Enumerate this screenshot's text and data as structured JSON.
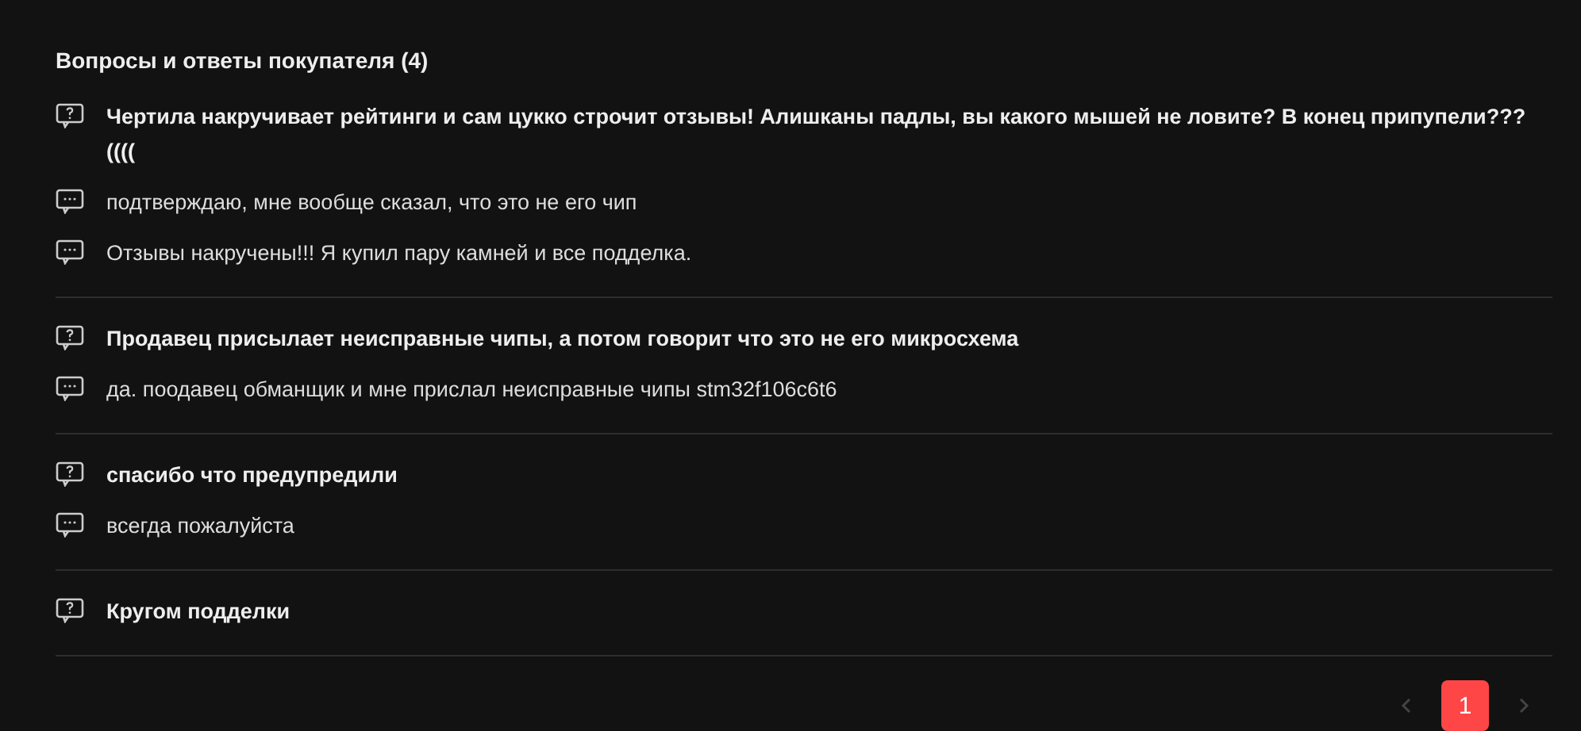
{
  "title": "Вопросы и ответы покупателя (4)",
  "threads": [
    {
      "question": "Чертила накручивает рейтинги и сам цукко строчит отзывы! Алишканы падлы, вы какого мышей не ловите? В конец припупели???((((",
      "answers": [
        "подтверждаю, мне вообще сказал, что это не его чип",
        "Отзывы накручены!!! Я купил пару камней и все подделка."
      ]
    },
    {
      "question": "Продавец присылает неисправные чипы, а потом говорит что это не его микросхема",
      "answers": [
        "да. поодавец обманщик и мне прислал неисправные чипы stm32f106c6t6"
      ]
    },
    {
      "question": "спасибо что предупредили",
      "answers": [
        "всегда пожалуйста"
      ]
    },
    {
      "question": "Кругом подделки"
    }
  ],
  "pagination": {
    "prev_disabled": true,
    "pages": [
      {
        "label": "1",
        "selected": true
      }
    ],
    "next_disabled": true
  }
}
